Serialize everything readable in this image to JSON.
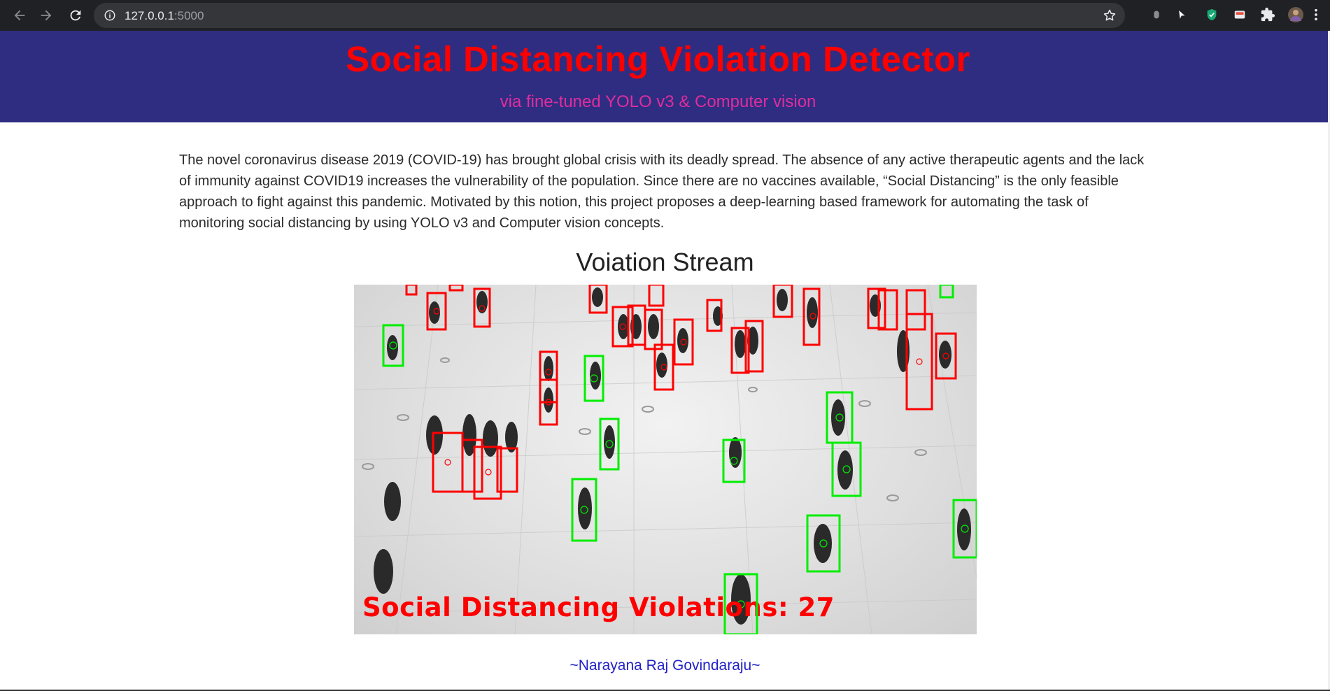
{
  "browser": {
    "url_host": "127.0.0.1",
    "url_port": ":5000",
    "icons": [
      "back-arrow-icon",
      "forward-arrow-icon",
      "reload-icon",
      "site-info-icon",
      "bookmark-star-icon",
      "extensions-puzzle-icon",
      "profile-avatar-icon",
      "menu-dots-icon"
    ]
  },
  "header": {
    "title": "Social Distancing Violation Detector",
    "subtitle": "via fine-tuned YOLO v3 & Computer vision"
  },
  "intro": {
    "text": "The novel coronavirus disease 2019 (COVID-19) has brought global crisis with its deadly spread. The absence of any active therapeutic agents and the lack of immunity against COVID19 increases the vulnerability of the population. Since there are no vaccines available, “Social Distancing” is the only feasible approach to fight against this pandemic. Motivated by this notion, this project proposes a deep-learning based framework for automating the task of monitoring social distancing by using YOLO v3 and Computer vision concepts."
  },
  "stream": {
    "heading": "Voiation Stream",
    "overlay_text": "Social Distancing Violations: 27",
    "violation_color": "#ff0000",
    "safe_color": "#00ee00"
  },
  "footer": {
    "author": "~Narayana Raj Govindaraju~"
  }
}
